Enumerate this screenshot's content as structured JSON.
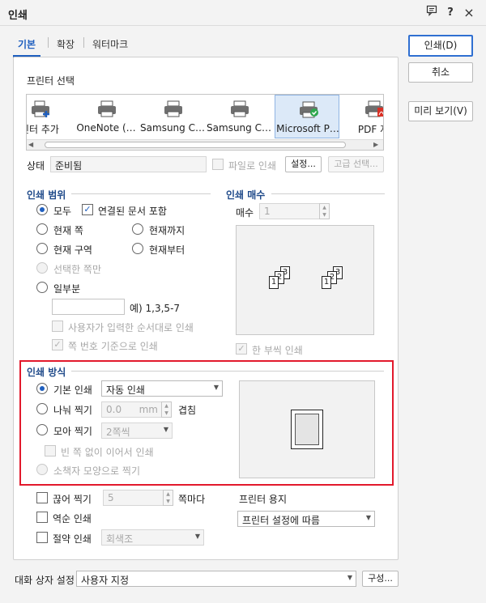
{
  "window": {
    "title": "인쇄",
    "icons": [
      "chat-icon",
      "help-icon",
      "close-icon"
    ],
    "help_glyph": "?",
    "close_glyph": "×"
  },
  "tabs": [
    "기본",
    "확장",
    "워터마크"
  ],
  "side_buttons": {
    "print": "인쇄(D)",
    "cancel": "취소",
    "preview": "미리 보기(V)"
  },
  "printer_select": {
    "title": "프린터 선택",
    "printers": [
      {
        "name": "린터 추가",
        "selected": false
      },
      {
        "name": "OneNote (…",
        "selected": false
      },
      {
        "name": "Samsung C…",
        "selected": false
      },
      {
        "name": "Samsung C…",
        "selected": false
      },
      {
        "name": "Microsoft P…",
        "selected": true
      },
      {
        "name": "PDF 저",
        "selected": false
      }
    ],
    "status_label": "상태",
    "status_value": "준비됨",
    "file_print_label": "파일로 인쇄",
    "settings_button": "설정...",
    "advanced_button": "고급 선택..."
  },
  "print_range": {
    "title": "인쇄 범위",
    "all": "모두",
    "include_linked": "연결된 문서 포함",
    "current_page": "현재 쪽",
    "until_current": "현재까지",
    "current_section": "현재 구역",
    "from_current": "현재부터",
    "selected_only": "선택한 쪽만",
    "partial": "일부분",
    "example": "예) 1,3,5-7",
    "user_order": "사용자가 입력한 순서대로 인쇄",
    "page_number_basis": "쪽 번호 기준으로 인쇄"
  },
  "copies": {
    "title": "인쇄 매수",
    "count_label": "매수",
    "count_value": "1",
    "collate": "한 부씩 인쇄",
    "pages": [
      "1",
      "2",
      "3"
    ]
  },
  "print_method": {
    "title": "인쇄 방식",
    "basic": "기본 인쇄",
    "basic_value": "자동 인쇄",
    "split": "나눠 찍기",
    "split_value": "0.0",
    "split_unit": "mm",
    "overlap": "겹침",
    "gather": "모아 찍기",
    "gather_value": "2쪽씩",
    "no_blank": "빈 쪽 없이 이어서 인쇄",
    "booklet": "소책자 모양으로 찍기"
  },
  "bottom": {
    "cut_print": "끊어 찍기",
    "cut_value": "5",
    "per_page": "쪽마다",
    "reverse": "역순 인쇄",
    "save_print": "절약 인쇄",
    "save_value": "회색조",
    "paper_label": "프린터 용지",
    "paper_value": "프린터 설정에 따름"
  },
  "footer": {
    "dialog_settings_label": "대화 상자 설정",
    "dialog_settings_value": "사용자 지정",
    "compose_button": "구성..."
  },
  "colors": {
    "accent": "#1f5fbf",
    "highlight_border": "#e2192c",
    "section_title": "#1f4a8a"
  }
}
